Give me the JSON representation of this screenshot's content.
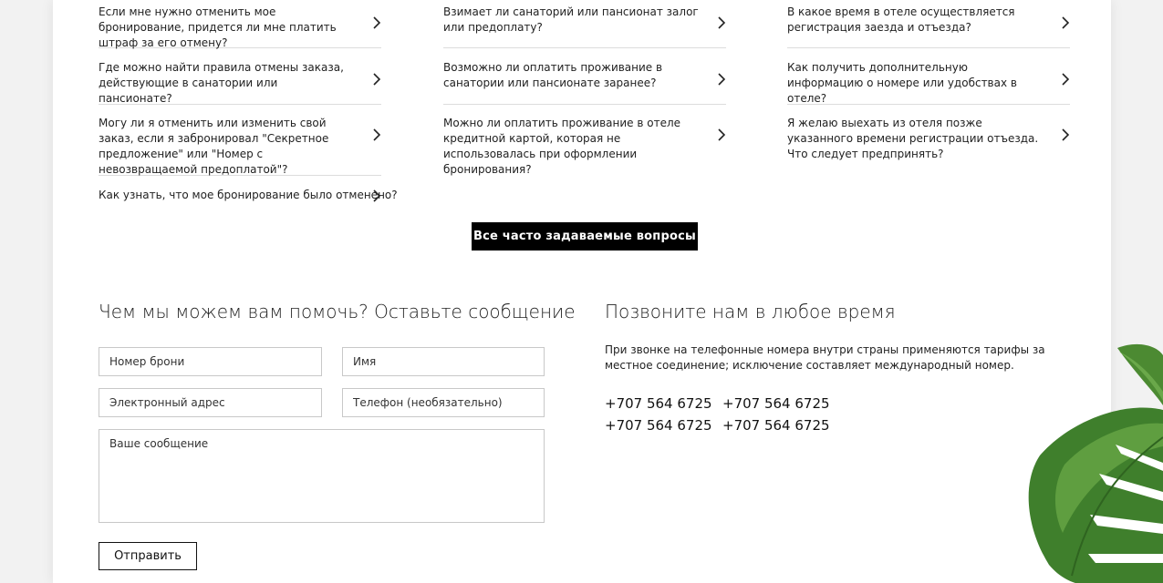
{
  "faq": {
    "columns": [
      [
        {
          "question": "Если мне нужно отменить мое бронирование, придется ли мне платить штраф за его отмену?"
        },
        {
          "question": "Где можно найти правила отмены заказа, действующие в санатории или пансионате?"
        },
        {
          "question": "Могу ли я отменить или изменить свой заказ, если я забронировал \"Секретное предложение\" или \"Номер с невозвращаемой предоплатой\"?"
        },
        {
          "question": "Как узнать, что мое бронирование было отменено?"
        }
      ],
      [
        {
          "question": "Взимает ли санаторий или пансионат залог или предоплату?"
        },
        {
          "question": "Возможно ли оплатить проживание в санатории или пансионате заранее?"
        },
        {
          "question": "Можно ли оплатить проживание в отеле кредитной картой, которая не использовалась при оформлении бронирования?"
        }
      ],
      [
        {
          "question": "В какое время в отеле осуществляется регистрация заезда и отъезда?"
        },
        {
          "question": "Как получить дополнительную информацию о номере или удобствах в отеле?"
        },
        {
          "question": "Я желаю выехать из отеля позже указанного времени регистрации отъезда. Что следует предпринять?"
        }
      ]
    ],
    "all_button_label": "Все часто задаваемые вопросы",
    "chevron_icon": "chevron-right-icon"
  },
  "message_form": {
    "title": "Чем мы можем вам помочь? Оставьте сообщение",
    "booking_number_placeholder": "Номер брони",
    "name_placeholder": "Имя",
    "email_placeholder": "Электронный адрес",
    "phone_placeholder": "Телефон (необязательно)",
    "message_placeholder": "Ваше сообщение",
    "submit_label": "Отправить"
  },
  "call_us": {
    "title": "Позвоните нам в любое время",
    "description": "При звонке на телефонные номера внутри страны применяются тарифы за местное соединение; исключение составляет международный номер.",
    "phones": [
      "+707 564 6725",
      "+707 564 6725",
      "+707 564 6725",
      "+707 564 6725"
    ]
  },
  "colors": {
    "page_background": "#f2f2f2",
    "card_background": "#ffffff",
    "primary_button": "#000000",
    "divider": "#dcdcdc",
    "leaf_green": "#3f7f2c"
  }
}
